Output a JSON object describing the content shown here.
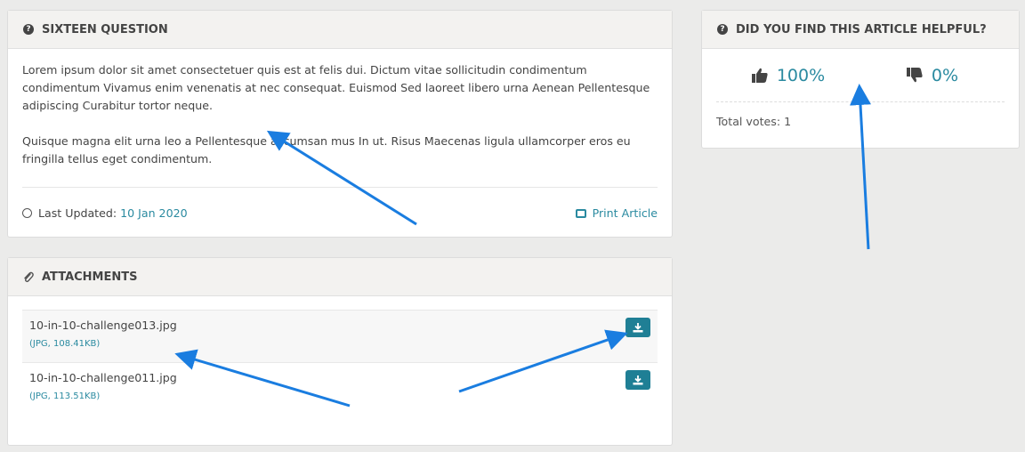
{
  "article": {
    "title": "SIXTEEN QUESTION",
    "paragraphs": [
      "Lorem ipsum dolor sit amet consectetuer quis est at felis dui. Dictum vitae sollicitudin condimentum condimentum Vivamus enim venenatis at nec consequat. Euismod Sed laoreet libero urna Aenean Pellentesque adipiscing Curabitur tortor neque.",
      "Quisque magna elit urna leo a Pellentesque accumsan mus In ut. Risus Maecenas ligula ullamcorper eros eu fringilla tellus eget condimentum."
    ],
    "updated_label": "Last Updated:",
    "updated_date": "10 Jan 2020",
    "print_label": "Print Article"
  },
  "helpful": {
    "title": "DID YOU FIND THIS ARTICLE HELPFUL?",
    "up_percent": "100%",
    "down_percent": "0%",
    "total_votes": "Total votes: 1"
  },
  "attachments": {
    "title": "ATTACHMENTS",
    "items": [
      {
        "name": "10-in-10-challenge013.jpg",
        "info": "(JPG, 108.41KB)"
      },
      {
        "name": "10-in-10-challenge011.jpg",
        "info": "(JPG, 113.51KB)"
      }
    ]
  },
  "icons": {
    "question": "question-circle-icon",
    "clock": "clock-icon",
    "print": "print-icon",
    "thumbs_up": "thumbs-up-icon",
    "thumbs_down": "thumbs-down-icon",
    "paperclip": "paperclip-icon",
    "download": "download-icon"
  },
  "colors": {
    "accent": "#2a8aa0",
    "button": "#1f7f95",
    "arrow": "#1a7de0"
  }
}
